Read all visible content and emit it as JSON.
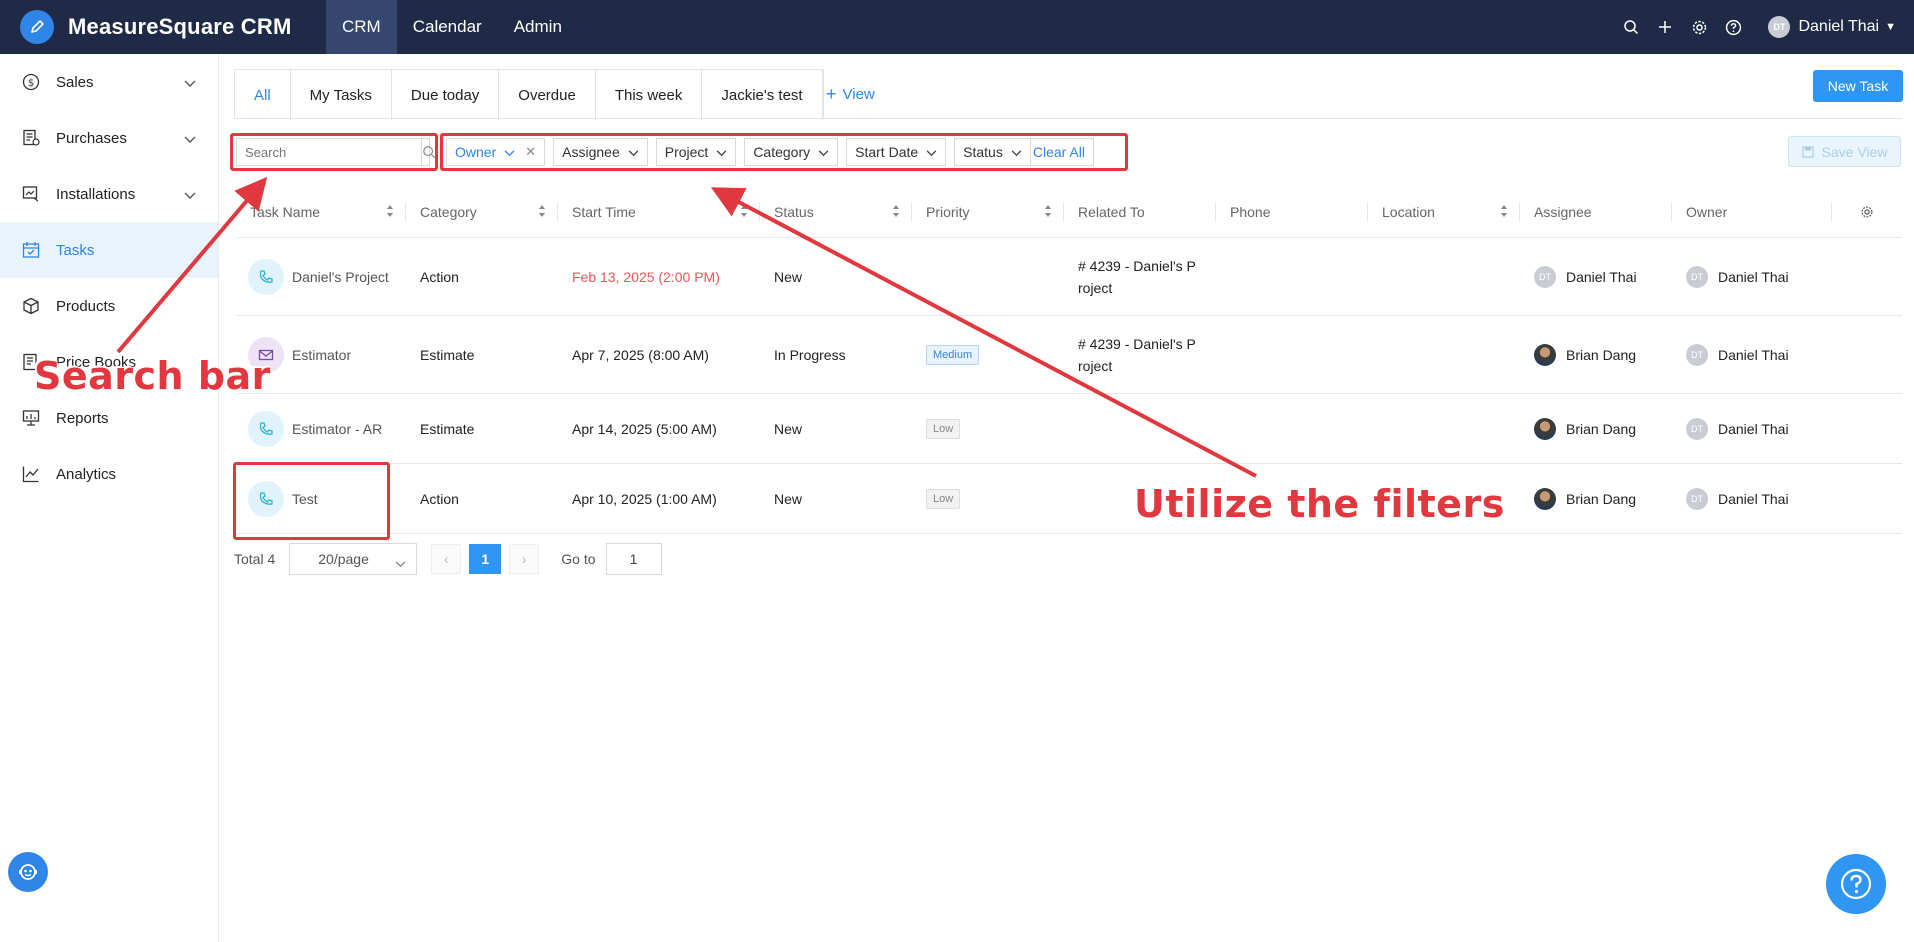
{
  "app": {
    "title": "MeasureSquare CRM"
  },
  "topnav": {
    "items": [
      "CRM",
      "Calendar",
      "Admin"
    ]
  },
  "user": {
    "initials": "DT",
    "name": "Daniel Thai"
  },
  "sidebar": {
    "items": [
      {
        "label": "Sales",
        "icon": "dollar-circle-icon"
      },
      {
        "label": "Purchases",
        "icon": "receipt-icon"
      },
      {
        "label": "Installations",
        "icon": "installation-icon"
      },
      {
        "label": "Tasks",
        "icon": "calendar-check-icon"
      },
      {
        "label": "Products",
        "icon": "box-icon"
      },
      {
        "label": "Price Books",
        "icon": "price-book-icon"
      },
      {
        "label": "Reports",
        "icon": "report-icon"
      },
      {
        "label": "Analytics",
        "icon": "line-chart-icon"
      }
    ]
  },
  "tabs": [
    "All",
    "My Tasks",
    "Due today",
    "Overdue",
    "This week",
    "Jackie's test"
  ],
  "add_view_label": "View",
  "new_task_label": "New Task",
  "search": {
    "placeholder": "Search"
  },
  "filters": [
    "Owner",
    "Assignee",
    "Project",
    "Category",
    "Start Date",
    "Status"
  ],
  "clear_all_label": "Clear All",
  "save_view_label": "Save View",
  "table": {
    "columns": [
      "Task Name",
      "Category",
      "Start Time",
      "Status",
      "Priority",
      "Related To",
      "Phone",
      "Location",
      "Assignee",
      "Owner"
    ],
    "rows": [
      {
        "name": "Daniel's Project",
        "icon": "phone-icon",
        "category": "Action",
        "start": "Feb 13, 2025 (2:00 PM)",
        "status": "New",
        "priority": "",
        "related1": "# 4239 - Daniel's P",
        "related2": "roject",
        "assignee": "Daniel Thai",
        "owner": "Daniel Thai"
      },
      {
        "name": "Estimator",
        "icon": "mail-icon",
        "category": "Estimate",
        "start": "Apr 7, 2025 (8:00 AM)",
        "status": "In Progress",
        "priority": "Medium",
        "related1": "# 4239 - Daniel's P",
        "related2": "roject",
        "assignee": "Brian Dang",
        "owner": "Daniel Thai"
      },
      {
        "name": "Estimator - AR",
        "icon": "phone-icon",
        "category": "Estimate",
        "start": "Apr 14, 2025 (5:00 AM)",
        "status": "New",
        "priority": "Low",
        "related1": "",
        "related2": "",
        "assignee": "Brian Dang",
        "owner": "Daniel Thai"
      },
      {
        "name": "Test",
        "icon": "phone-icon",
        "category": "Action",
        "start": "Apr 10, 2025 (1:00 AM)",
        "status": "New",
        "priority": "Low",
        "related1": "",
        "related2": "",
        "assignee": "Brian Dang",
        "owner": "Daniel Thai"
      }
    ]
  },
  "pagination": {
    "total_label": "Total 4",
    "page_size": "20/page",
    "current_page": "1",
    "goto_label": "Go to",
    "goto_value": "1"
  },
  "annotations": {
    "search_label": "Search bar",
    "filters_label": "Utilize the filters"
  },
  "colors": {
    "topbar": "#1f2b46",
    "accent": "#2f86e6",
    "annotation": "#e0383e",
    "overdue": "#f0555a"
  }
}
